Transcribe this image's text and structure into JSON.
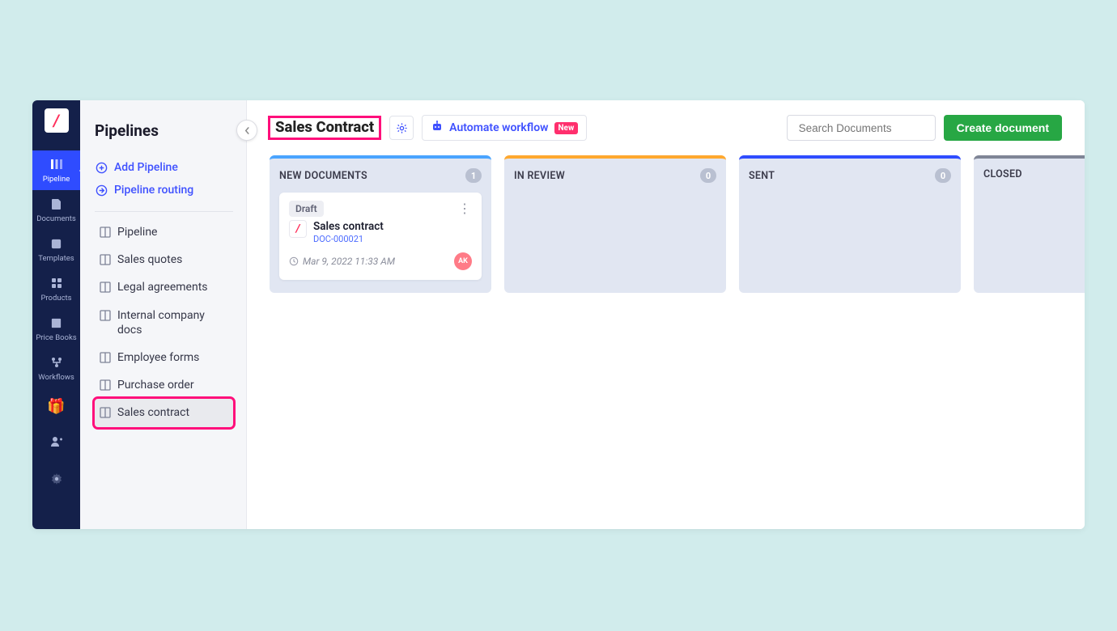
{
  "rail": {
    "logo_glyph": "/",
    "items": [
      {
        "label": "Pipeline",
        "active": true
      },
      {
        "label": "Documents",
        "active": false
      },
      {
        "label": "Templates",
        "active": false
      },
      {
        "label": "Products",
        "active": false
      },
      {
        "label": "Price Books",
        "active": false
      },
      {
        "label": "Workflows",
        "active": false
      }
    ]
  },
  "sidebar": {
    "title": "Pipelines",
    "add_pipeline_label": "Add Pipeline",
    "pipeline_routing_label": "Pipeline routing",
    "list": [
      "Pipeline",
      "Sales quotes",
      "Legal agreements",
      "Internal company docs",
      "Employee forms",
      "Purchase order",
      "Sales contract"
    ],
    "selected_index": 6
  },
  "header": {
    "title": "Sales Contract",
    "automate_label": "Automate workflow",
    "automate_badge": "New",
    "search_placeholder": "Search Documents",
    "create_button": "Create document"
  },
  "board": {
    "columns": [
      {
        "title": "NEW DOCUMENTS",
        "count": 1,
        "accent": "#4aa4ff"
      },
      {
        "title": "IN REVIEW",
        "count": 0,
        "accent": "#ffa82f"
      },
      {
        "title": "SENT",
        "count": 0,
        "accent": "#2f4cff"
      },
      {
        "title": "CLOSED",
        "count": "",
        "accent": "#7f8596"
      }
    ],
    "card": {
      "status": "Draft",
      "title": "Sales contract",
      "doc_id": "DOC-000021",
      "timestamp": "Mar 9, 2022 11:33 AM",
      "avatar_initials": "AK",
      "logo_glyph": "/"
    }
  }
}
